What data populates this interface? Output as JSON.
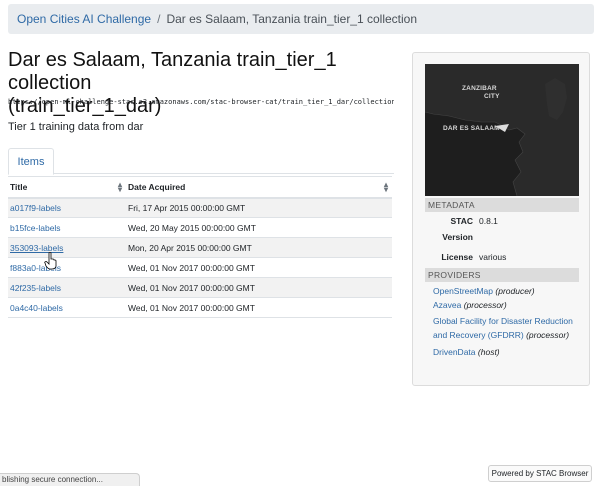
{
  "breadcrumb": {
    "root": "Open Cities AI Challenge",
    "separator": "/",
    "current": "Dar es Salaam, Tanzania train_tier_1 collection"
  },
  "page": {
    "title_line1": "Dar es Salaam, Tanzania train_tier_1 collection",
    "title_line2": "(train_tier_1_dar)",
    "url": "https://open-ml-challenge-stac.s3.amazonaws.com/stac-browser-cat/train_tier_1_dar/collection.json",
    "description": "Tier 1 training data from dar"
  },
  "tabs": [
    {
      "label": "Items"
    }
  ],
  "table": {
    "columns": [
      "Title",
      "Date Acquired"
    ],
    "rows": [
      {
        "title": "a017f9-labels",
        "date": "Fri, 17 Apr 2015 00:00:00 GMT"
      },
      {
        "title": "b15fce-labels",
        "date": "Wed, 20 May 2015 00:00:00 GMT"
      },
      {
        "title": "353093-labels",
        "date": "Mon, 20 Apr 2015 00:00:00 GMT"
      },
      {
        "title": "f883a0-labels",
        "date": "Wed, 01 Nov 2017 00:00:00 GMT"
      },
      {
        "title": "42f235-labels",
        "date": "Wed, 01 Nov 2017 00:00:00 GMT"
      },
      {
        "title": "0a4c40-labels",
        "date": "Wed, 01 Nov 2017 00:00:00 GMT"
      }
    ]
  },
  "map": {
    "label_zanzibar_1": "ZANZIBAR",
    "label_zanzibar_2": "CITY",
    "label_dar": "DAR ES SALAAM"
  },
  "metadata": {
    "heading": "METADATA",
    "stac_version_key_1": "STAC",
    "stac_version_key_2": "Version",
    "stac_version_value": "0.8.1",
    "license_key": "License",
    "license_value": "various"
  },
  "providers": {
    "heading": "PROVIDERS",
    "items": [
      {
        "name": "OpenStreetMap",
        "role": "(producer)"
      },
      {
        "name": "Azavea",
        "role": "(processor)"
      },
      {
        "name": "Global Facility for Disaster Reduction and Recovery (GFDRR)",
        "role": "(processor)"
      },
      {
        "name": "DrivenData",
        "role": "(host)"
      }
    ]
  },
  "status_text": "blishing secure connection...",
  "footer": {
    "powered_by": "Powered by STAC Browser"
  },
  "colors": {
    "link": "#2f6aa6",
    "breadcrumb_bg": "#e9ecef",
    "map_bg": "#1e1e1e"
  },
  "icons": [
    "sort-icon",
    "mouse-pointer-icon",
    "map-marker-icon"
  ]
}
